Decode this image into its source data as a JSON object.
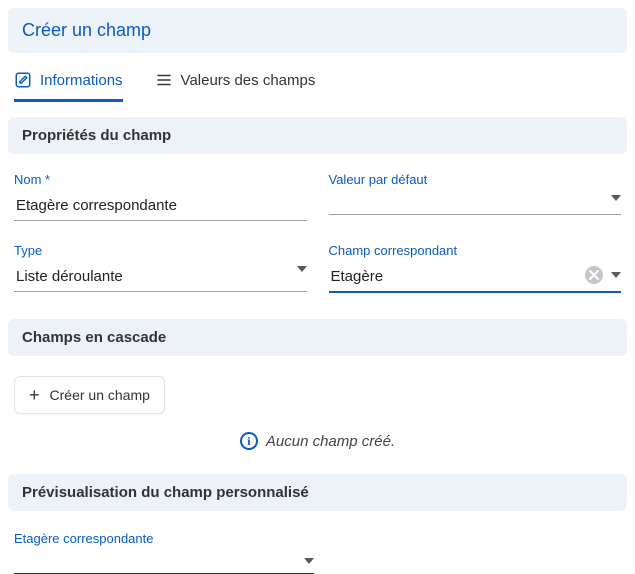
{
  "page": {
    "title": "Créer un champ"
  },
  "tabs": {
    "info_label": "Informations",
    "values_label": "Valeurs des champs"
  },
  "sections": {
    "properties": "Propriétés du champ",
    "cascade": "Champs en cascade",
    "preview": "Prévisualisation du champ personnalisé"
  },
  "fields": {
    "name": {
      "label": "Nom *",
      "value": "Etagère correspondante"
    },
    "default_value": {
      "label": "Valeur par défaut",
      "value": ""
    },
    "type": {
      "label": "Type",
      "value": "Liste déroulante"
    },
    "corresponding": {
      "label": "Champ correspondant",
      "value": "Etagère"
    }
  },
  "cascade": {
    "create_label": "Créer un champ",
    "empty_text": "Aucun champ créé."
  },
  "preview": {
    "field_label": "Etagère correspondante",
    "field_value": ""
  }
}
